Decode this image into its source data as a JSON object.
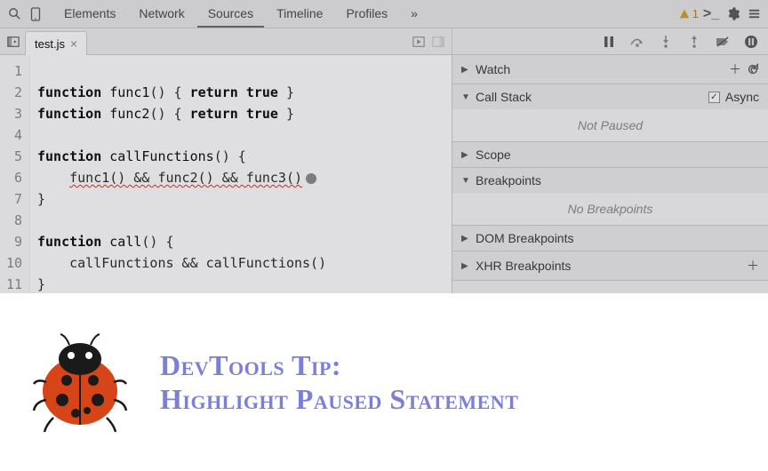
{
  "toolbar": {
    "tabs": [
      "Elements",
      "Network",
      "Sources",
      "Timeline",
      "Profiles"
    ],
    "active_tab": "Sources",
    "overflow_glyph": "»",
    "warning_count": "1"
  },
  "file_tab": {
    "name": "test.js"
  },
  "editor": {
    "lines": [
      "",
      "function func1() { return true }",
      "function func2() { return true }",
      "",
      "function callFunctions() {",
      "    func1() && func2() && func3()",
      "}",
      "",
      "function call() {",
      "    callFunctions && callFunctions()",
      "}"
    ],
    "line_numbers": [
      "1",
      "2",
      "3",
      "4",
      "5",
      "6",
      "7",
      "8",
      "9",
      "10",
      "11"
    ]
  },
  "panes": {
    "watch": {
      "title": "Watch"
    },
    "callstack": {
      "title": "Call Stack",
      "async_label": "Async",
      "async_checked": true,
      "body": "Not Paused"
    },
    "scope": {
      "title": "Scope"
    },
    "breakpoints": {
      "title": "Breakpoints",
      "body": "No Breakpoints"
    },
    "dom": {
      "title": "DOM Breakpoints"
    },
    "xhr": {
      "title": "XHR Breakpoints"
    }
  },
  "tip": {
    "line1": "DevTools Tip:",
    "line2": "Highlight Paused Statement"
  }
}
